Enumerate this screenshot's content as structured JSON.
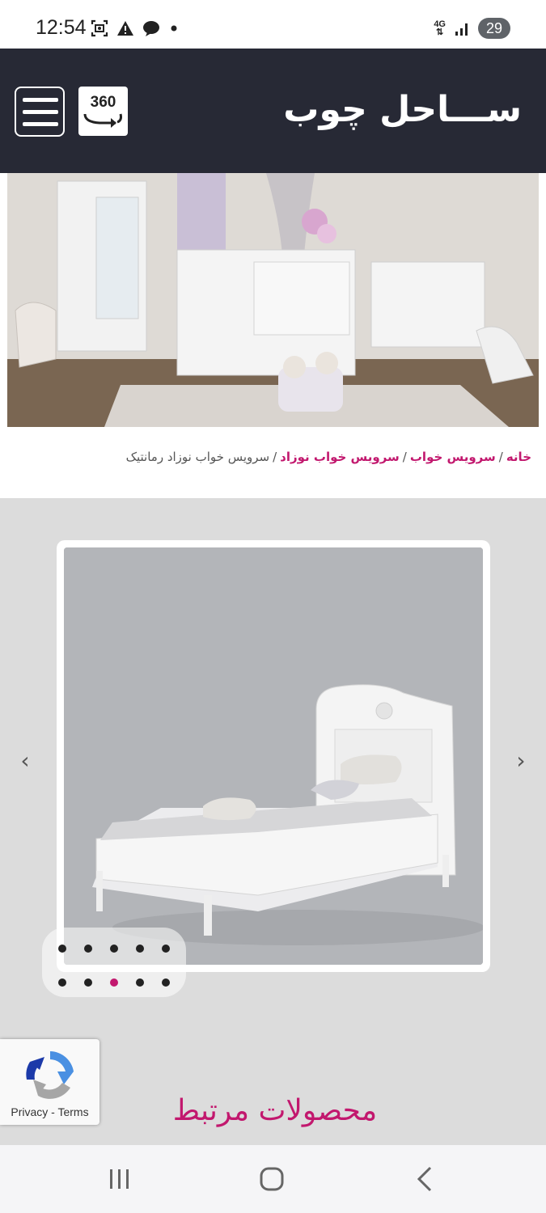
{
  "status_bar": {
    "time": "12:54",
    "network": "4G",
    "battery": "29",
    "icons_left": [
      "screenshot-icon",
      "alert-icon",
      "chat-bubble-icon",
      "dot-icon"
    ],
    "icons_right": [
      "network-4g-icon",
      "signal-icon",
      "battery-icon"
    ]
  },
  "header": {
    "logo_text": "ســـاحل چوب",
    "button_360_label": "360",
    "background_color": "#272935"
  },
  "breadcrumb": {
    "items": [
      "خانه",
      "سرویس خواب",
      "سرویس خواب نوزاد",
      "سرویس خواب نوزاد رمانتیک"
    ],
    "separator": "/"
  },
  "gallery": {
    "prev_symbol": "‹",
    "next_symbol": "›",
    "dot_count": 10,
    "active_dot_index": 7
  },
  "recaptcha": {
    "privacy_label": "Privacy",
    "terms_label": "Terms",
    "link_separator": "-"
  },
  "related_products_title": "محصولات مرتبط",
  "colors": {
    "accent": "#c2186e",
    "header_bg": "#272935",
    "gallery_bg": "#dcdcdc"
  },
  "nav_bar": {
    "icons": [
      "recents-icon",
      "home-icon",
      "back-icon"
    ]
  }
}
